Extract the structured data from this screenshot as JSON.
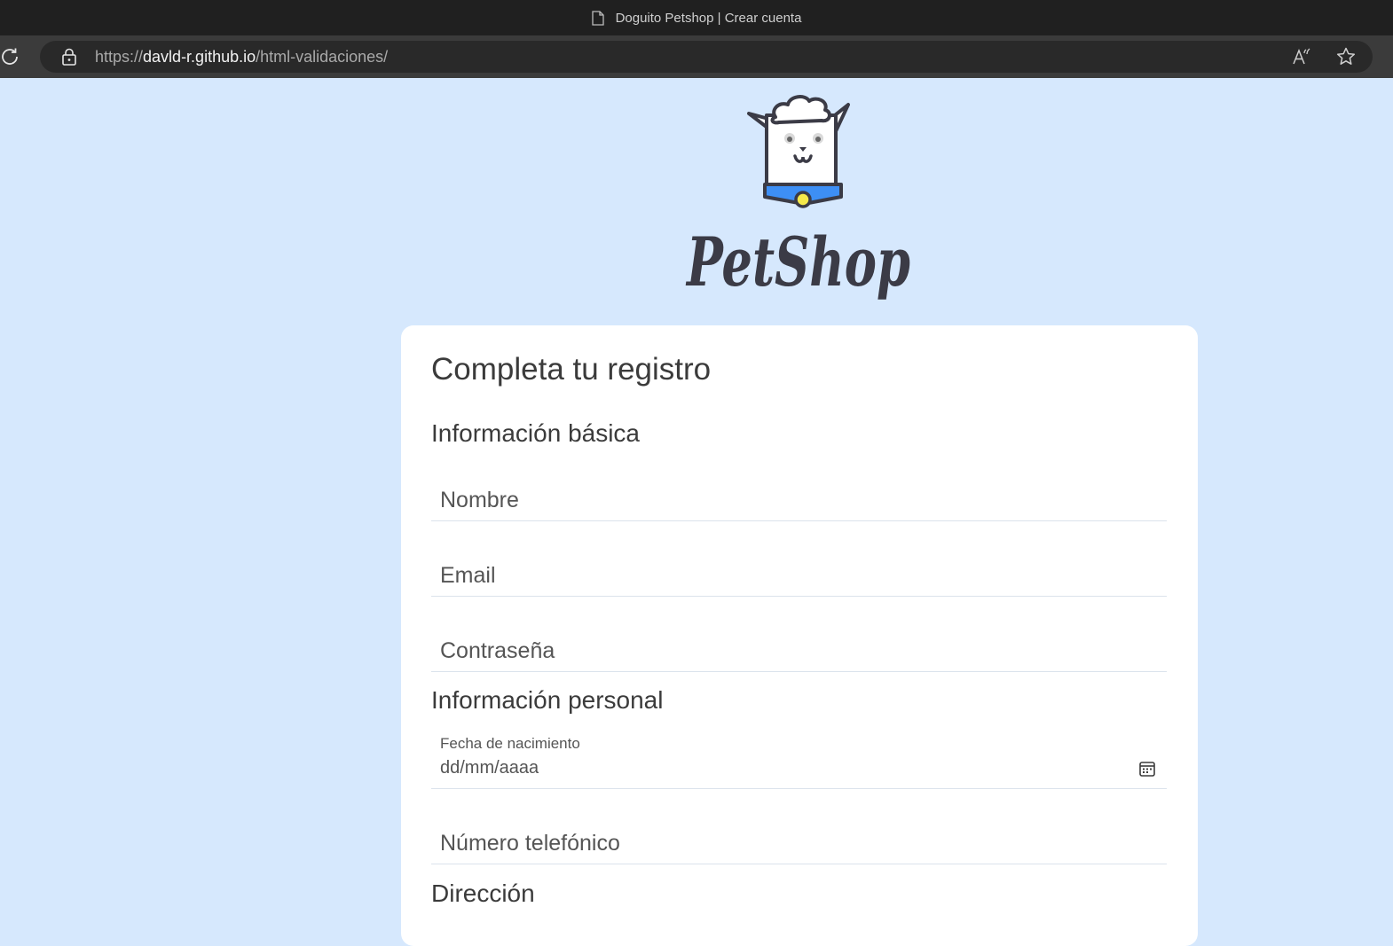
{
  "browser": {
    "tab_title": "Doguito Petshop | Crear cuenta",
    "url_scheme": "https://",
    "url_host": "davld-r.github.io",
    "url_path": "/html-validaciones/"
  },
  "brand": {
    "logo_text": "PetShop",
    "dog_icon": "dog-logo-icon"
  },
  "form": {
    "title": "Completa tu registro",
    "section_basic": "Información básica",
    "name_placeholder": "Nombre",
    "email_placeholder": "Email",
    "password_placeholder": "Contraseña",
    "section_personal": "Información personal",
    "birthdate_label": "Fecha de nacimiento",
    "birthdate_placeholder": "dd/mm/aaaa",
    "phone_placeholder": "Número telefónico",
    "section_address": "Dirección"
  },
  "colors": {
    "page_bg": "#d6e8fd",
    "collar": "#3d8ff5",
    "tag": "#f5e94a",
    "ink": "#3b3b46"
  }
}
